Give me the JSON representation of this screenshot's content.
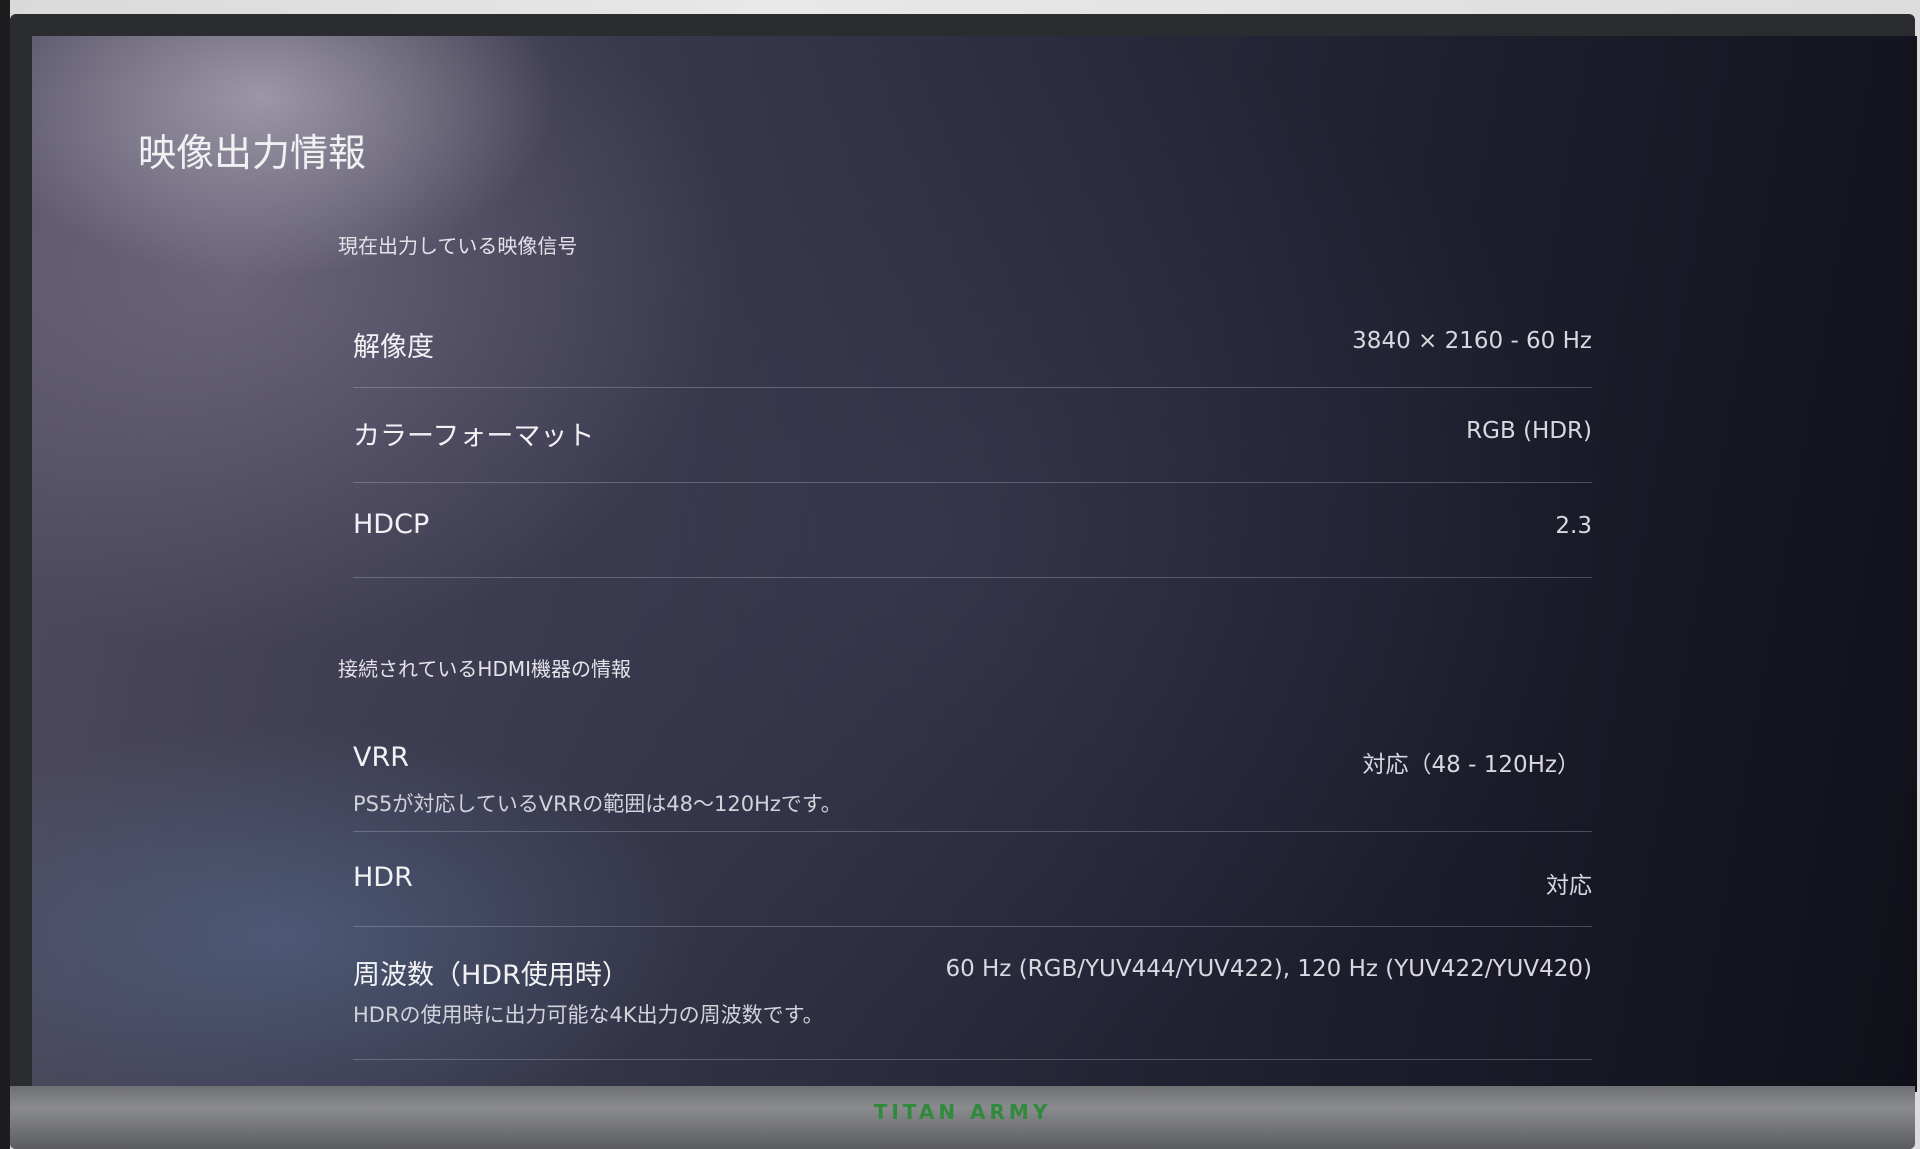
{
  "page_title": "映像出力情報",
  "sections": [
    {
      "heading": "現在出力している映像信号",
      "rows": [
        {
          "label": "解像度",
          "value": "3840 × 2160 - 60 Hz"
        },
        {
          "label": "カラーフォーマット",
          "value": "RGB (HDR)"
        },
        {
          "label": "HDCP",
          "value": "2.3"
        }
      ]
    },
    {
      "heading": "接続されているHDMI機器の情報",
      "rows": [
        {
          "label": "VRR",
          "value": "対応（48 - 120Hz）",
          "description": "PS5が対応しているVRRの範囲は48～120Hzです。"
        },
        {
          "label": "HDR",
          "value": "対応"
        },
        {
          "label": "周波数（HDR使用時）",
          "value": "60 Hz (RGB/YUV444/YUV422), 120 Hz (YUV422/YUV420)",
          "description": "HDRの使用時に出力可能な4K出力の周波数です。"
        }
      ]
    }
  ],
  "monitor_brand": "TITAN ARMY",
  "colors": {
    "brand_green": "#2f8a3c",
    "text_primary": "#f2f2f5",
    "divider": "rgba(210,210,225,0.28)"
  }
}
